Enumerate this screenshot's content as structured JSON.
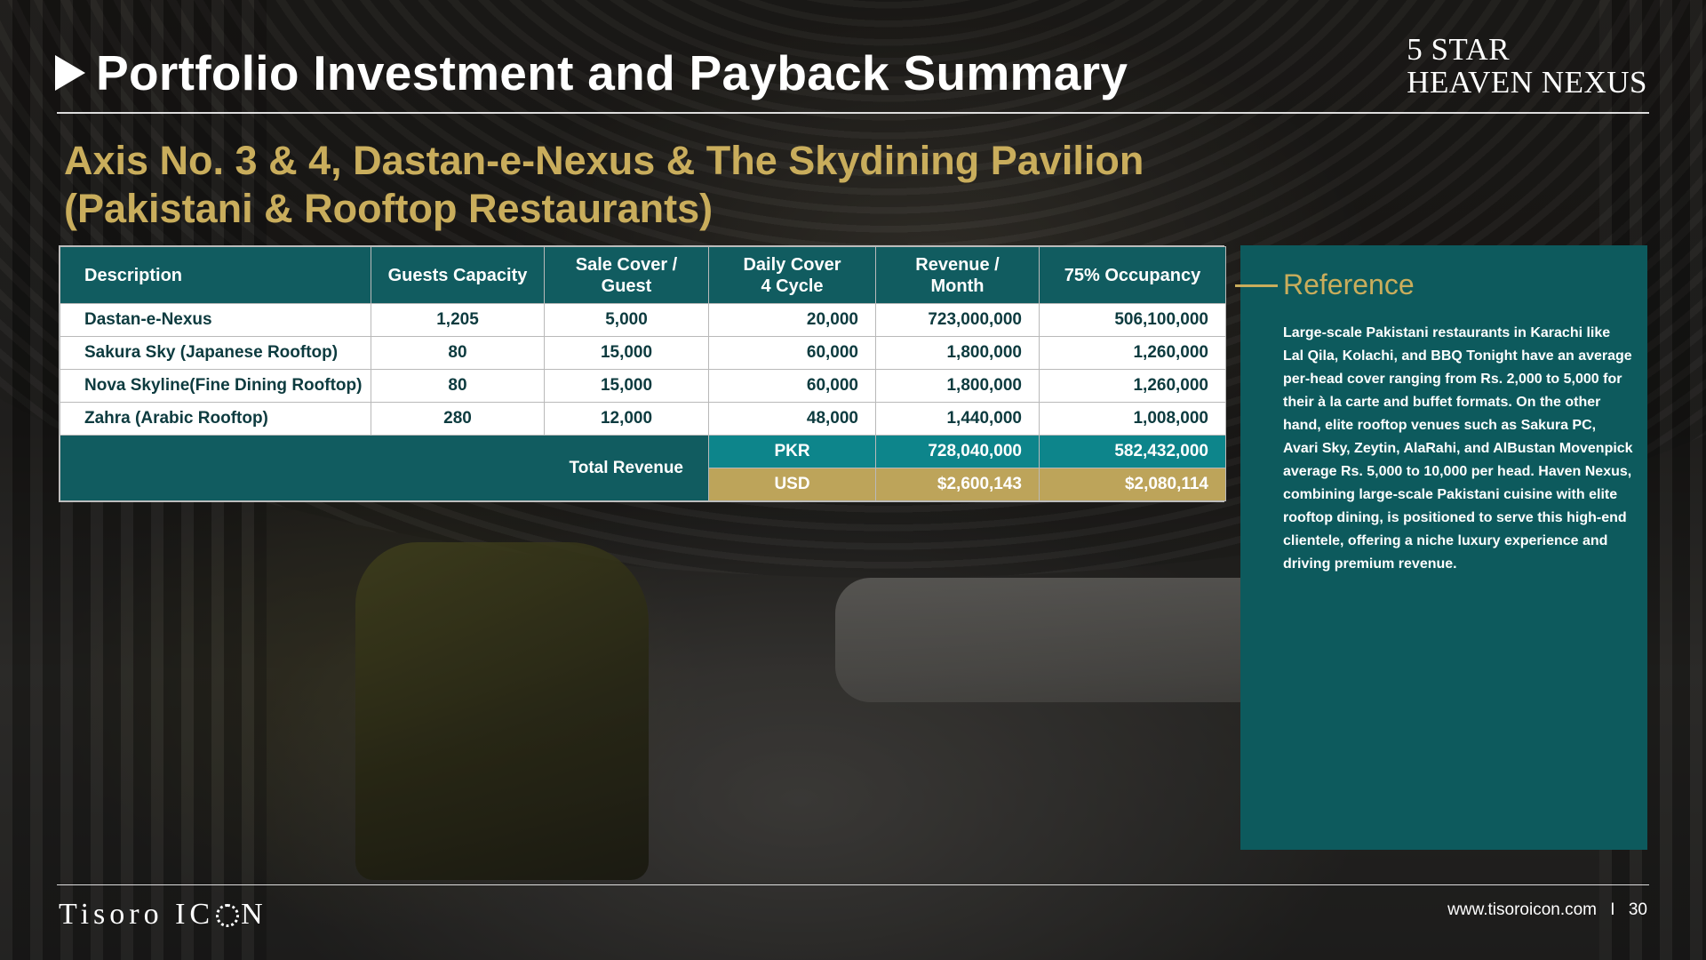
{
  "header": {
    "title": "Portfolio Investment and Payback Summary",
    "brand_line1": "5 STAR",
    "brand_line2": "HEAVEN NEXUS"
  },
  "subtitle": {
    "line1": "Axis No. 3 & 4, Dastan-e-Nexus & The Skydining Pavilion",
    "line2": "(Pakistani & Rooftop Restaurants)"
  },
  "table": {
    "headers": {
      "description": "Description",
      "guests_capacity": "Guests Capacity",
      "sale_cover_l1": "Sale Cover /",
      "sale_cover_l2": "Guest",
      "daily_cover_l1": "Daily Cover",
      "daily_cover_l2": "4 Cycle",
      "revenue_l1": "Revenue /",
      "revenue_l2": "Month",
      "occupancy": "75% Occupancy"
    },
    "rows": [
      {
        "description": "Dastan-e-Nexus",
        "guests": "1,205",
        "sale_cover": "5,000",
        "daily_cover": "20,000",
        "revenue": "723,000,000",
        "occupancy": "506,100,000"
      },
      {
        "description": "Sakura Sky (Japanese Rooftop)",
        "guests": "80",
        "sale_cover": "15,000",
        "daily_cover": "60,000",
        "revenue": "1,800,000",
        "occupancy": "1,260,000"
      },
      {
        "description": "Nova Skyline(Fine Dining Rooftop)",
        "guests": "80",
        "sale_cover": "15,000",
        "daily_cover": "60,000",
        "revenue": "1,800,000",
        "occupancy": "1,260,000"
      },
      {
        "description": "Zahra (Arabic Rooftop)",
        "guests": "280",
        "sale_cover": "12,000",
        "daily_cover": "48,000",
        "revenue": "1,440,000",
        "occupancy": "1,008,000"
      }
    ],
    "total": {
      "label": "Total Revenue",
      "pkr": {
        "currency": "PKR",
        "revenue": "728,040,000",
        "occupancy": "582,432,000"
      },
      "usd": {
        "currency": "USD",
        "revenue": "$2,600,143",
        "occupancy": "$2,080,114"
      }
    }
  },
  "reference": {
    "title": "Reference",
    "body": "Large-scale Pakistani restaurants in Karachi like Lal Qila, Kolachi, and BBQ Tonight have an average per-head cover ranging from Rs. 2,000 to 5,000 for their à la carte and buffet formats. On the other hand, elite rooftop venues such as Sakura PC, Avari Sky, Zeytin, AlaRahi, and AlBustan Movenpick average Rs. 5,000 to 10,000 per head. Haven Nexus, combining large-scale Pakistani cuisine with elite rooftop dining, is positioned to serve this high-end clientele, offering a niche luxury experience and driving premium revenue."
  },
  "footer": {
    "logo_part1": "Tisoro IC",
    "logo_part2": "N",
    "website": "www.tisoroicon.com",
    "separator": "I",
    "page_number": "30"
  },
  "colors": {
    "teal_header": "#115c60",
    "teal_pkr": "#0d858b",
    "gold": "#c9ad5c",
    "gold_usd": "#bda45a",
    "panel": "#0d5a5d"
  }
}
